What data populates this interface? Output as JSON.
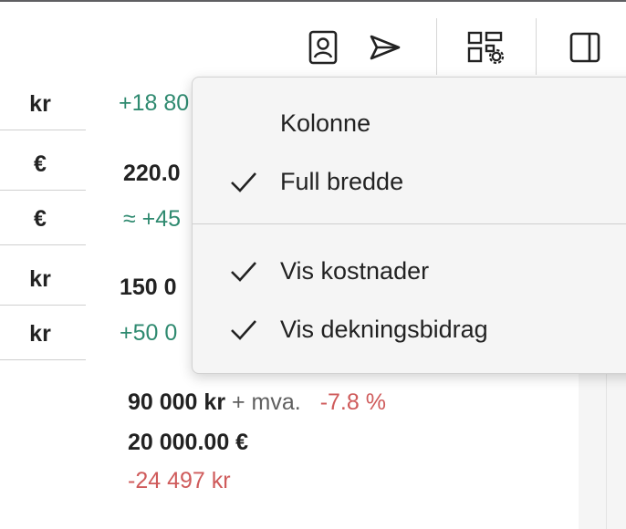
{
  "toolbar": {
    "icons": [
      "contact-icon",
      "send-icon",
      "dashboard-settings-icon",
      "panel-toggle-icon"
    ]
  },
  "table": {
    "units": [
      "kr",
      "€",
      "€",
      "kr",
      "kr"
    ],
    "values": [
      {
        "text": "+18 80",
        "tone": "green"
      },
      {
        "text": "220.0",
        "tone": "bold"
      },
      {
        "text": "≈ +45",
        "tone": "green"
      },
      {
        "text": "150 0",
        "tone": "bold"
      },
      {
        "text": "+50 0",
        "tone": "green"
      }
    ]
  },
  "summary": {
    "price": "90 000 kr",
    "vat": "+ mva.",
    "percent": "-7.8 %",
    "euro": "20 000.00 €",
    "diff": "-24 497 kr"
  },
  "menu": {
    "items": [
      {
        "label": "Kolonne",
        "checked": false
      },
      {
        "label": "Full bredde",
        "checked": true
      },
      {
        "label": "Vis kostnader",
        "checked": true
      },
      {
        "label": "Vis dekningsbidrag",
        "checked": true
      }
    ]
  },
  "colors": {
    "positive": "#2f8a70",
    "negative": "#cf5b5b",
    "menu_bg": "#f5f5f5"
  }
}
